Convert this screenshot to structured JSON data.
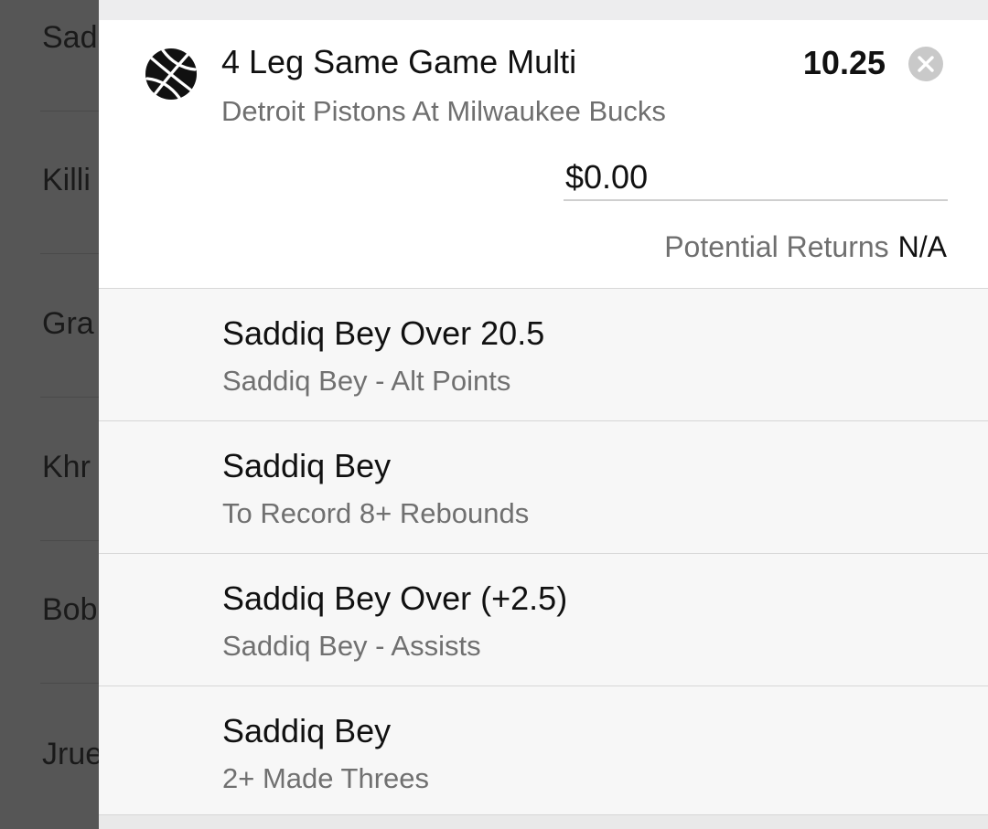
{
  "background_list": {
    "rows": [
      "Sad",
      "Killi",
      "Gra",
      "Khr",
      "Bob",
      "Jrue"
    ]
  },
  "bet": {
    "sport_icon": "basketball-icon",
    "title": "4 Leg Same Game Multi",
    "odds": "10.25",
    "remove_icon": "close-circle-icon",
    "event": "Detroit Pistons At Milwaukee Bucks",
    "stake_value": "$0.00",
    "returns_label": "Potential Returns",
    "returns_value": "N/A"
  },
  "legs": [
    {
      "title": "Saddiq Bey Over 20.5",
      "subtitle": "Saddiq Bey - Alt Points"
    },
    {
      "title": "Saddiq Bey",
      "subtitle": "To Record 8+ Rebounds"
    },
    {
      "title": "Saddiq Bey Over (+2.5)",
      "subtitle": "Saddiq Bey - Assists"
    },
    {
      "title": "Saddiq Bey",
      "subtitle": "2+ Made Threes"
    }
  ],
  "colors": {
    "overlay": "#565656",
    "card": "#ffffff",
    "leg_background": "#f7f7f7",
    "text_primary": "#111111",
    "text_secondary": "#6f6f6f"
  }
}
